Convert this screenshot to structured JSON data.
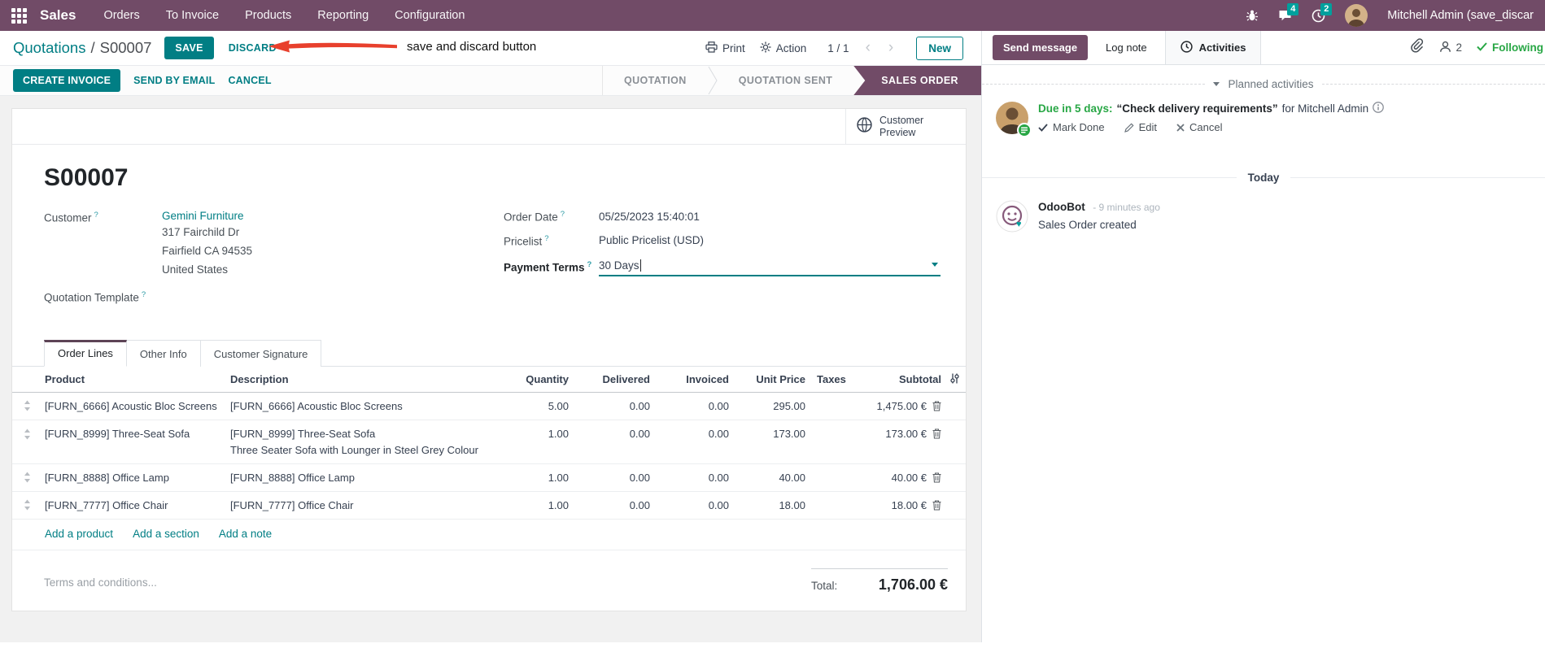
{
  "colors": {
    "brand_purple": "#714B67",
    "primary_teal": "#017E84",
    "badge_teal": "#00A09D",
    "success_green": "#28a745",
    "annotation_red": "#e8402d"
  },
  "ui": {
    "help": "?"
  },
  "nav": {
    "app_label": "Sales",
    "items": [
      "Orders",
      "To Invoice",
      "Products",
      "Reporting",
      "Configuration"
    ],
    "chat_badge": "4",
    "clock_badge": "2",
    "user_name": "Mitchell Admin (save_discar"
  },
  "breadcrumb": {
    "parent": "Quotations",
    "separator": "/",
    "current": "S00007"
  },
  "actions": {
    "save": "SAVE",
    "discard": "DISCARD",
    "print": "Print",
    "action": "Action",
    "pager": "1 / 1",
    "prev": "‹",
    "next": "›",
    "new": "New"
  },
  "annotation": {
    "label": "save and discard button"
  },
  "statusbar": {
    "create_invoice": "CREATE INVOICE",
    "send_by_email": "SEND BY EMAIL",
    "cancel": "CANCEL",
    "steps": [
      {
        "label": "QUOTATION"
      },
      {
        "label": "QUOTATION SENT"
      },
      {
        "label": "SALES ORDER"
      }
    ]
  },
  "sheet": {
    "preview_label": "Customer Preview",
    "title": "S00007",
    "fields": {
      "customer_label": "Customer",
      "customer_name": "Gemini Furniture",
      "customer_address": [
        "317 Fairchild Dr",
        "Fairfield CA 94535",
        "United States"
      ],
      "quotation_template_label": "Quotation Template",
      "order_date_label": "Order Date",
      "order_date_value": "05/25/2023 15:40:01",
      "pricelist_label": "Pricelist",
      "pricelist_value": "Public Pricelist (USD)",
      "payment_terms_label": "Payment Terms",
      "payment_terms_value": "30 Days"
    },
    "tabs": [
      {
        "label": "Order Lines"
      },
      {
        "label": "Other Info"
      },
      {
        "label": "Customer Signature"
      }
    ],
    "table": {
      "headers": [
        "Product",
        "Description",
        "Quantity",
        "Delivered",
        "Invoiced",
        "Unit Price",
        "Taxes",
        "Subtotal"
      ],
      "rows": [
        {
          "product": "[FURN_6666] Acoustic Bloc Screens",
          "description": "[FURN_6666] Acoustic Bloc Screens",
          "description2": "",
          "quantity": "5.00",
          "delivered": "0.00",
          "invoiced": "0.00",
          "unit_price": "295.00",
          "taxes": "",
          "subtotal": "1,475.00 €"
        },
        {
          "product": "[FURN_8999] Three-Seat Sofa",
          "description": "[FURN_8999] Three-Seat Sofa",
          "description2": "Three Seater Sofa with Lounger in Steel Grey Colour",
          "quantity": "1.00",
          "delivered": "0.00",
          "invoiced": "0.00",
          "unit_price": "173.00",
          "taxes": "",
          "subtotal": "173.00 €"
        },
        {
          "product": "[FURN_8888] Office Lamp",
          "description": "[FURN_8888] Office Lamp",
          "description2": "",
          "quantity": "1.00",
          "delivered": "0.00",
          "invoiced": "0.00",
          "unit_price": "40.00",
          "taxes": "",
          "subtotal": "40.00 €"
        },
        {
          "product": "[FURN_7777] Office Chair",
          "description": "[FURN_7777] Office Chair",
          "description2": "",
          "quantity": "1.00",
          "delivered": "0.00",
          "invoiced": "0.00",
          "unit_price": "18.00",
          "taxes": "",
          "subtotal": "18.00 €"
        }
      ],
      "links": [
        "Add a product",
        "Add a section",
        "Add a note"
      ]
    },
    "terms_placeholder": "Terms and conditions...",
    "total_label": "Total:",
    "total_value": "1,706.00 €"
  },
  "chatter": {
    "send_message": "Send message",
    "log_note": "Log note",
    "activities": "Activities",
    "followers_count": "2",
    "following": "Following",
    "planned_header": "Planned activities",
    "activity": {
      "due": "Due in 5 days:",
      "summary": "“Check delivery requirements”",
      "for_text": "for Mitchell Admin",
      "mark_done": "Mark Done",
      "edit": "Edit",
      "cancel": "Cancel"
    },
    "today": "Today",
    "message": {
      "author": "OdooBot",
      "time": "- 9 minutes ago",
      "body": "Sales Order created"
    }
  }
}
